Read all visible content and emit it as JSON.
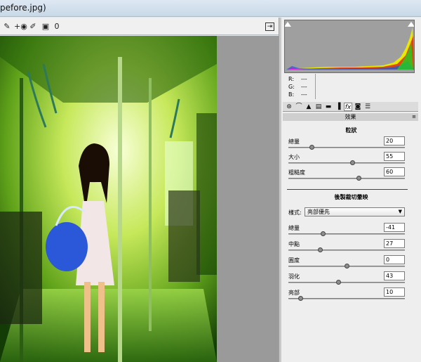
{
  "window": {
    "title": "pefore.jpg)"
  },
  "toolbar": {
    "tools": [
      {
        "name": "white-balance-tool-icon",
        "glyph": "✎"
      },
      {
        "name": "red-eye-tool-icon",
        "glyph": "+◉"
      },
      {
        "name": "brush-tool-icon",
        "glyph": "✐"
      },
      {
        "name": "graduated-filter-icon",
        "glyph": "▣"
      },
      {
        "name": "rotate-tool-icon",
        "glyph": "0"
      }
    ],
    "open_icon": "open-object-icon"
  },
  "rgb": {
    "r_label": "R:",
    "g_label": "G:",
    "b_label": "B:",
    "r_value": "---",
    "g_value": "---",
    "b_value": "---"
  },
  "tabs": [
    "basic",
    "tone-curve",
    "detail",
    "hsl",
    "split-toning",
    "lens",
    "fx",
    "camera-calibration",
    "presets"
  ],
  "panel": {
    "header": "效果",
    "grain": {
      "title": "粒狀",
      "rows": [
        {
          "label": "總量",
          "value": "20",
          "fraction": 0.2
        },
        {
          "label": "大小",
          "value": "55",
          "fraction": 0.55
        },
        {
          "label": "粗糙度",
          "value": "60",
          "fraction": 0.6
        }
      ]
    },
    "vignette": {
      "title": "後製裁切暈映",
      "style_label": "樣式:",
      "style_value": "亮部優先",
      "rows": [
        {
          "label": "總量",
          "value": "-41",
          "fraction": 0.295
        },
        {
          "label": "中點",
          "value": "27",
          "fraction": 0.27
        },
        {
          "label": "圓度",
          "value": "0",
          "fraction": 0.5
        },
        {
          "label": "羽化",
          "value": "43",
          "fraction": 0.43
        },
        {
          "label": "亮部",
          "value": "10",
          "fraction": 0.1
        }
      ]
    }
  },
  "colors": {
    "panel_bg": "#eeeeee",
    "canvas_bg": "#9a9a9a",
    "photo_green": "#7fbf2a"
  }
}
